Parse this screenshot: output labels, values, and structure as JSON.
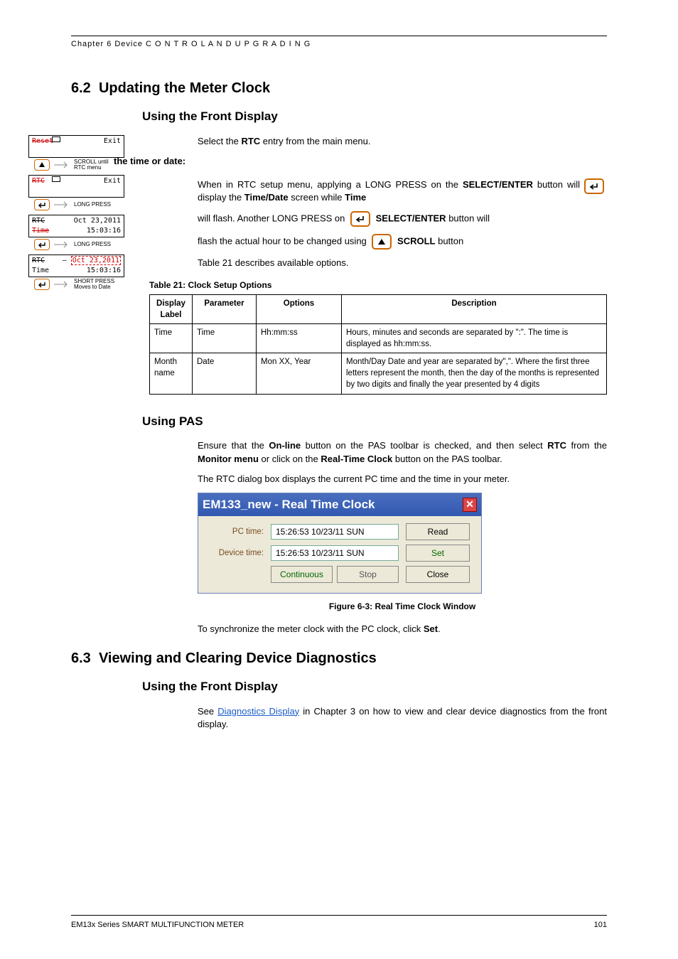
{
  "header": {
    "chapter": "Chapter 6  Device  C O N T R O L   A N D   U P G R A D I N G"
  },
  "s62": {
    "num": "6.2",
    "title": "Updating the Meter Clock",
    "sub1": "Using the Front Display",
    "intro_a": "Select the ",
    "intro_b": "RTC",
    "intro_c": " entry from the main menu.",
    "intro_line2": "the time or date:",
    "p1a": "When in RTC setup menu, applying a LONG PRESS on the ",
    "p1b": "SELECT/ENTER",
    "p1c": " button will display the ",
    "p1d": "Time/Date",
    "p1e": " screen while ",
    "p1f": "Time",
    "p2a": "will flash. Another LONG PRESS on ",
    "p2b": "SELECT/ENTER",
    "p2c": " button will",
    "p3a": "flash the actual hour to be changed using ",
    "p3b": "SCROLL",
    "p3c": " button",
    "p4": "Table 21 describes available options.",
    "tbl_caption": "Table 21:  Clock Setup Options",
    "headers": {
      "c1": "Display Label",
      "c2": "Parameter",
      "c3": "Options",
      "c4": "Description"
    },
    "rows": [
      {
        "c1": "Time",
        "c2": "Time",
        "c3": "Hh:mm:ss",
        "c4": "Hours, minutes and seconds are separated by \":\". The time is displayed as hh:mm:ss."
      },
      {
        "c1": "Month name",
        "c2": "Date",
        "c3": "Mon XX, Year",
        "c4": "Month/Day Date and year are separated by\",\". Where the first three letters represent the month, then the day of the months is represented by two digits and finally the year presented by 4 digits"
      }
    ],
    "sub2": "Using PAS",
    "pas1a": "Ensure that the ",
    "pas1b": "On-line",
    "pas1c": " button on the PAS toolbar is checked, and then select ",
    "pas1d": "RTC",
    "pas1e": " from the ",
    "pas1f": "Monitor menu",
    "pas1g": " or click on the ",
    "pas1h": "Real-Time Clock",
    "pas1i": " button on the PAS toolbar.",
    "pas2": "The RTC dialog box displays the current PC time and the time in your meter.",
    "rtc": {
      "title": "EM133_new - Real Time Clock",
      "pc_label": "PC time:",
      "dev_label": "Device time:",
      "pc_val": "15:26:53 10/23/11 SUN",
      "dev_val": "15:26:53 10/23/11 SUN",
      "read": "Read",
      "set": "Set",
      "close": "Close",
      "cont": "Continuous",
      "stop": "Stop"
    },
    "fig_caption": "Figure 6-3:  Real Time Clock Window",
    "sync_a": "To synchronize the meter clock with the PC clock, click ",
    "sync_b": "Set",
    "sync_c": "."
  },
  "s63": {
    "num": "6.3",
    "title": "Viewing and Clearing Device Diagnostics",
    "sub1": "Using the Front Display",
    "p_a": "See ",
    "link": "Diagnostics Display",
    "p_b": " in Chapter 3 on how to view and clear device diagnostics from the front display."
  },
  "diag": {
    "reset": "Reset",
    "exit": "Exit",
    "scroll_until": "SCROLL until",
    "rtc_menu": "RTC menu",
    "rtc": "RTC",
    "long_press": "LONG PRESS",
    "date": "Oct 23,2011",
    "time_lbl": "Time",
    "time_val": "15:03:16",
    "date_dashed": "Oct 23,2011",
    "short_press": "SHORT PRESS",
    "moves": "Moves to Date"
  },
  "footer": {
    "left": "EM13x Series SMART MULTIFUNCTION METER",
    "right": "101"
  }
}
